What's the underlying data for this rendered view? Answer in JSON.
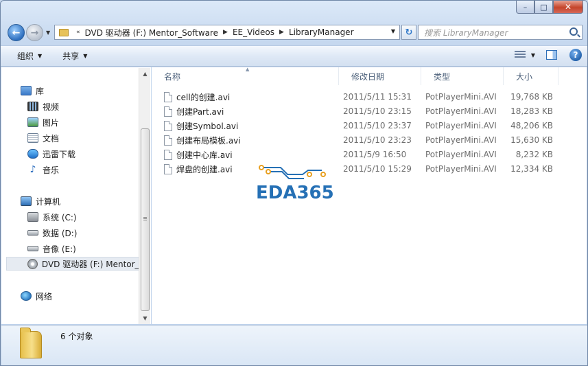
{
  "window": {
    "controls": {
      "minimize": "–",
      "maximize": "□",
      "close": "✕"
    }
  },
  "address": {
    "history_glyph": "«",
    "crumbs": [
      "DVD 驱动器 (F:) Mentor_Software",
      "EE_Videos",
      "LibraryManager"
    ],
    "separator": "▶"
  },
  "search": {
    "placeholder": "搜索 LibraryManager"
  },
  "toolbar": {
    "organize": "组织",
    "share": "共享",
    "help": "?"
  },
  "nav": {
    "favorites_group": {
      "label": "库",
      "items": [
        "视频",
        "图片",
        "文档",
        "迅雷下载",
        "音乐"
      ]
    },
    "computer_group": {
      "label": "计算机",
      "items": [
        "系统 (C:)",
        "数据 (D:)",
        "音像 (E:)",
        "DVD 驱动器 (F:) Mentor_S"
      ]
    },
    "network": {
      "label": "网络"
    }
  },
  "columns": {
    "name": "名称",
    "date": "修改日期",
    "type": "类型",
    "size": "大小"
  },
  "files": [
    {
      "name": "cell的创建.avi",
      "date": "2011/5/11 15:31",
      "type": "PotPlayerMini.AVI",
      "size": "19,768 KB"
    },
    {
      "name": "创建Part.avi",
      "date": "2011/5/10 23:15",
      "type": "PotPlayerMini.AVI",
      "size": "18,283 KB"
    },
    {
      "name": "创建Symbol.avi",
      "date": "2011/5/10 23:37",
      "type": "PotPlayerMini.AVI",
      "size": "48,206 KB"
    },
    {
      "name": "创建布局模板.avi",
      "date": "2011/5/10 23:23",
      "type": "PotPlayerMini.AVI",
      "size": "15,630 KB"
    },
    {
      "name": "创建中心库.avi",
      "date": "2011/5/9 16:50",
      "type": "PotPlayerMini.AVI",
      "size": "8,232 KB"
    },
    {
      "name": "焊盘的创建.avi",
      "date": "2011/5/10 15:29",
      "type": "PotPlayerMini.AVI",
      "size": "12,334 KB"
    }
  ],
  "logo": {
    "text": "EDA365",
    "color": "#2570b5",
    "accent": "#e8a020"
  },
  "status": {
    "item_count": "6 个对象"
  },
  "colors": {
    "selection_bg": "#e6ebf2",
    "accent_blue": "#2e6fbf"
  }
}
